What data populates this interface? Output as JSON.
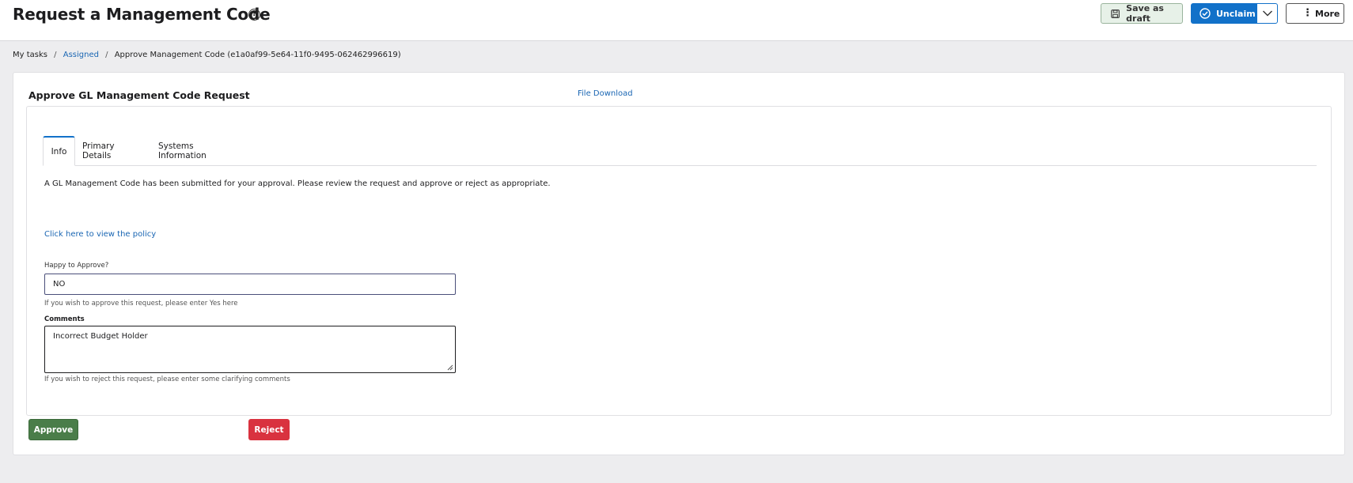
{
  "header": {
    "title": "Request a Management Code",
    "help_icon": "question-circle-icon",
    "save_draft_label": "Save as draft",
    "unclaim_label": "Unclaim",
    "more_label": "More"
  },
  "breadcrumb": {
    "items": [
      "My tasks",
      "Assigned",
      "Approve Management Code (e1a0af99-5e64-11f0-9495-062462996619)"
    ]
  },
  "section": {
    "title": "Approve GL Management Code Request",
    "file_download": "File Download"
  },
  "tabs": [
    {
      "label": "Info",
      "active": true
    },
    {
      "label": "Primary Details",
      "active": false
    },
    {
      "label": "Systems Information",
      "active": false
    }
  ],
  "info": {
    "text": "A GL Management Code has been submitted for your approval. Please review the request and approve or reject as appropriate.",
    "policy_link": "Click here to view the policy"
  },
  "form": {
    "approve_label": "Happy to Approve?",
    "approve_value": "NO",
    "approve_help": "If you wish to approve this request, please enter Yes here",
    "comments_label": "Comments",
    "comments_value": "Incorrect Budget Holder",
    "comments_help": "If you wish to reject this request, please enter some clarifying comments"
  },
  "actions": {
    "approve_label": "Approve",
    "reject_label": "Reject"
  },
  "colors": {
    "primary": "#1271c9",
    "approve": "#4a7d49",
    "reject": "#d9323f",
    "draft_bg": "#e7f1e8"
  }
}
